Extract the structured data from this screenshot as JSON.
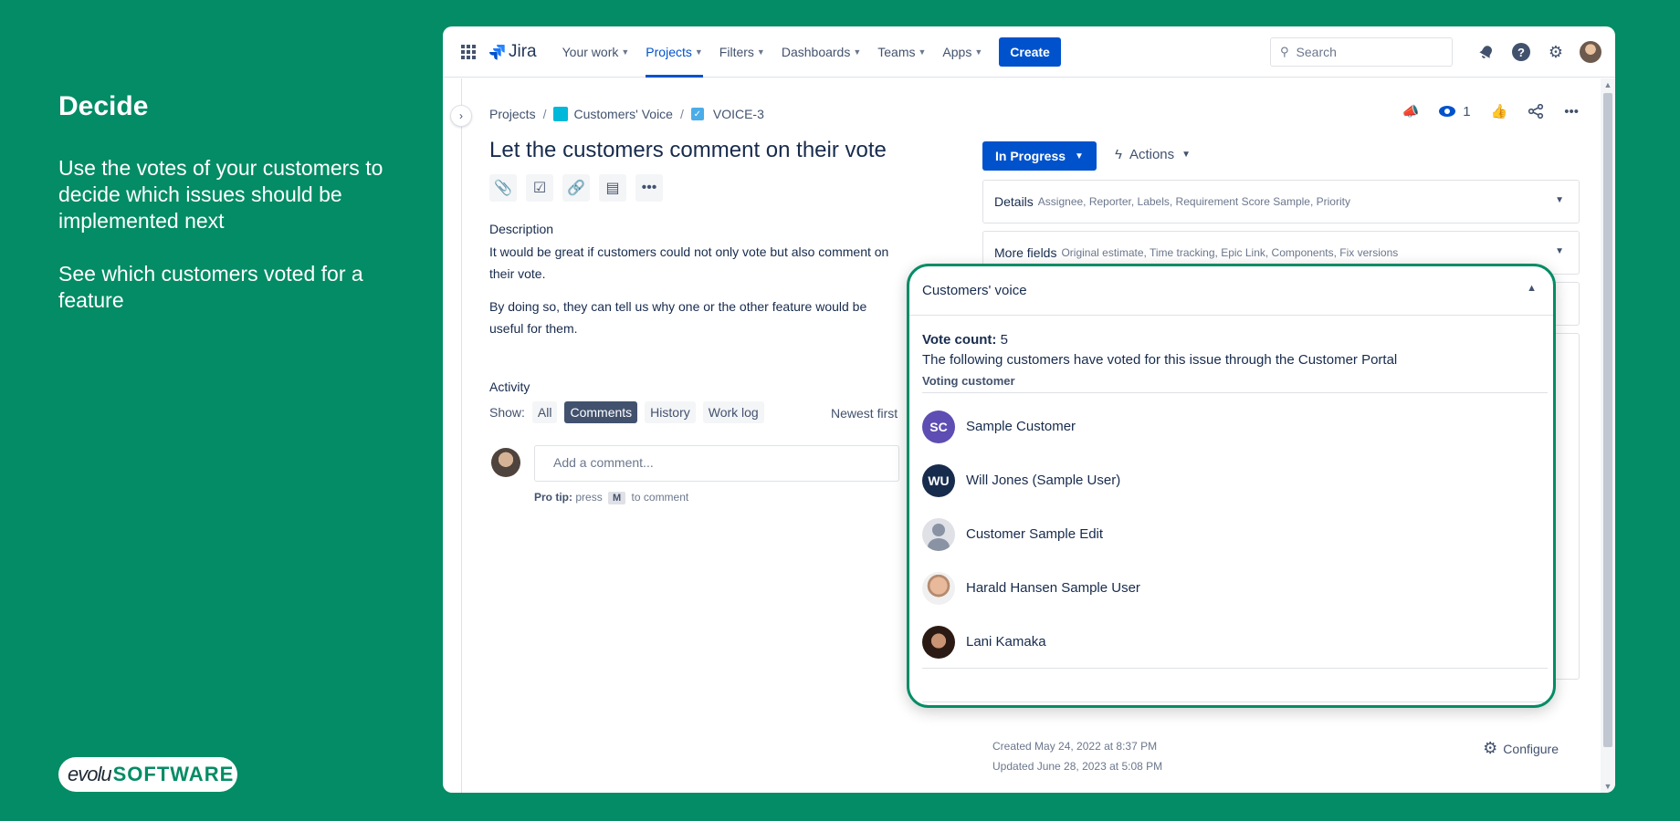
{
  "promo": {
    "title": "Decide",
    "paragraph1": "Use the votes of your customers to decide which issues should be implemented next",
    "paragraph2": "See which customers voted for a feature",
    "logo_evo": "evolu",
    "logo_software": "SOFTWARE",
    "accent_color": "#038c65"
  },
  "topnav": {
    "product": "Jira",
    "items": [
      {
        "label": "Your work",
        "active": false
      },
      {
        "label": "Projects",
        "active": true
      },
      {
        "label": "Filters",
        "active": false
      },
      {
        "label": "Dashboards",
        "active": false
      },
      {
        "label": "Teams",
        "active": false
      },
      {
        "label": "Apps",
        "active": false
      }
    ],
    "create_label": "Create",
    "search_placeholder": "Search"
  },
  "breadcrumb": {
    "root": "Projects",
    "project": "Customers' Voice",
    "issue_key": "VOICE-3"
  },
  "issue": {
    "watch_count": "1",
    "title": "Let the customers comment on their vote",
    "description_label": "Description",
    "description_p1": "It would be great if customers could not only vote but also comment on their vote.",
    "description_p2": "By doing so, they can tell us why one or the other feature would be useful for them.",
    "status": "In Progress",
    "actions_label": "Actions"
  },
  "activity": {
    "label": "Activity",
    "show_label": "Show:",
    "filters": [
      "All",
      "Comments",
      "History",
      "Work log"
    ],
    "selected_filter": "Comments",
    "sort": "Newest first",
    "comment_placeholder": "Add a comment...",
    "pro_tip_label": "Pro tip:",
    "pro_tip_pre": "press",
    "pro_tip_key": "M",
    "pro_tip_post": "to comment"
  },
  "panels": {
    "details_title": "Details",
    "details_fields": "Assignee, Reporter, Labels, Requirement Score Sample, Priority",
    "more_title": "More fields",
    "more_fields": "Original estimate, Time tracking, Epic Link, Components, Fix versions"
  },
  "meta": {
    "created": "Created May 24, 2022 at 8:37 PM",
    "updated": "Updated June 28, 2023 at 5:08 PM",
    "configure_label": "Configure"
  },
  "voice": {
    "title": "Customers' voice",
    "vote_count_label": "Vote count:",
    "vote_count": "5",
    "description": "The following customers have voted for this issue through the Customer Portal",
    "column_header": "Voting customer",
    "voters": [
      {
        "name": "Sample Customer",
        "initials": "SC"
      },
      {
        "name": "Will Jones (Sample User)",
        "initials": "WU"
      },
      {
        "name": "Customer Sample Edit",
        "initials": ""
      },
      {
        "name": "Harald Hansen Sample User",
        "initials": ""
      },
      {
        "name": "Lani Kamaka",
        "initials": ""
      }
    ]
  }
}
